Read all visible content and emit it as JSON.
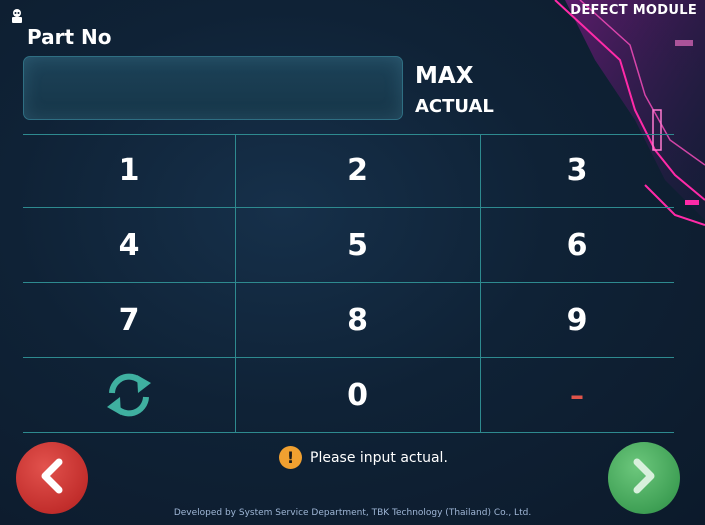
{
  "header": {
    "module_title": "DEFECT MODULE"
  },
  "form": {
    "part_label": "Part No",
    "part_value": "",
    "max_label": "MAX",
    "actual_label": "ACTUAL"
  },
  "keypad": {
    "keys": [
      "1",
      "2",
      "3",
      "4",
      "5",
      "6",
      "7",
      "8",
      "9",
      "refresh-icon",
      "0",
      "minus"
    ],
    "zero": "0",
    "minus": "–",
    "digits": {
      "k1": "1",
      "k2": "2",
      "k3": "3",
      "k4": "4",
      "k5": "5",
      "k6": "6",
      "k7": "7",
      "k8": "8",
      "k9": "9"
    }
  },
  "status": {
    "icon": "warning-icon",
    "icon_glyph": "!",
    "message": "Please input actual."
  },
  "nav": {
    "back_icon": "chevron-left-icon",
    "next_icon": "chevron-right-icon"
  },
  "footer": {
    "text": "Developed by System Service Department, TBK Technology (Thailand) Co., Ltd."
  },
  "colors": {
    "background": "#0f2236",
    "grid_line": "#2e8a8f",
    "back_button": "#c22e2c",
    "next_button": "#3fa055",
    "warning": "#f0a030",
    "refresh_icon": "#3fb0a0",
    "minus": "#e0544a",
    "accent_magenta": "#e0138c"
  }
}
